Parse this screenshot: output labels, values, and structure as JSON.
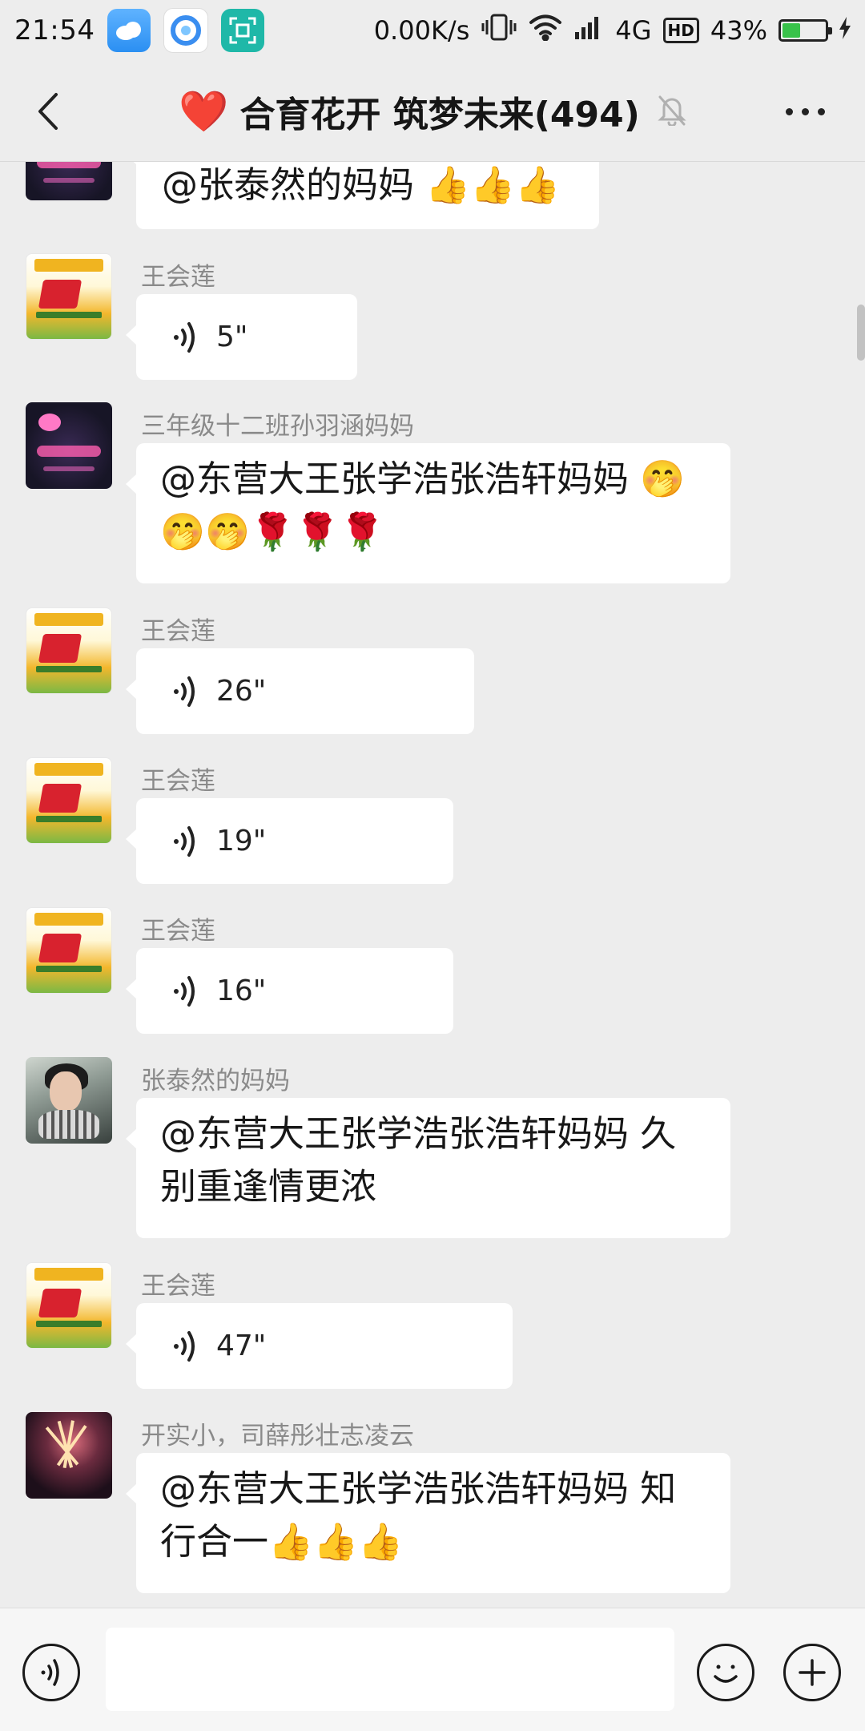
{
  "status_bar": {
    "time": "21:54",
    "net_speed": "0.00K/s",
    "network_type": "4G",
    "hd_label": "HD",
    "battery_percent": "43%",
    "battery_level": 0.43
  },
  "header": {
    "heart": "❤️",
    "title": "合育花开 筑梦未来(494)"
  },
  "messages": [
    {
      "sender": "",
      "text": "@张泰然的妈妈 👍👍👍"
    },
    {
      "sender": "王会莲",
      "voice": "5\""
    },
    {
      "sender": "三年级十二班孙羽涵妈妈",
      "text": "@东营大王张学浩张浩轩妈妈 🤭🤭🤭🌹🌹🌹"
    },
    {
      "sender": "王会莲",
      "voice": "26\""
    },
    {
      "sender": "王会莲",
      "voice": "19\""
    },
    {
      "sender": "王会莲",
      "voice": "16\""
    },
    {
      "sender": "张泰然的妈妈",
      "text": "@东营大王张学浩张浩轩妈妈  久别重逢情更浓"
    },
    {
      "sender": "王会莲",
      "voice": "47\""
    },
    {
      "sender": "开实小，司薛彤壮志凌云",
      "text": "@东营大王张学浩张浩轩妈妈  知行合一👍👍👍"
    }
  ],
  "input": {
    "value": "",
    "placeholder": ""
  },
  "colors": {
    "background": "#ededed",
    "bubble": "#ffffff",
    "sender_text": "#8a8a8a",
    "heart": "#e3262a"
  }
}
